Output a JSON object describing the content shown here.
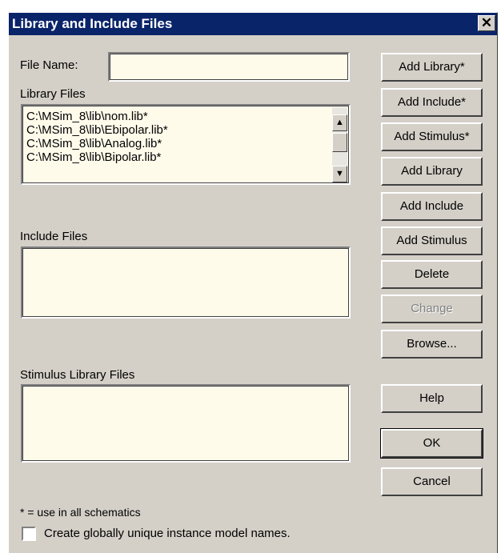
{
  "dialog": {
    "title": "Library and Include Files",
    "close_label": "✕"
  },
  "file_name": {
    "label": "File Name:",
    "value": "",
    "placeholder": ""
  },
  "library_files": {
    "label": "Library Files",
    "items": [
      "C:\\MSim_8\\lib\\nom.lib*",
      "C:\\MSim_8\\lib\\Ebipolar.lib*",
      "C:\\MSim_8\\lib\\Analog.lib*",
      "C:\\MSim_8\\lib\\Bipolar.lib*"
    ],
    "scroll_up_icon": "▲",
    "scroll_down_icon": "▼"
  },
  "include_files": {
    "label": "Include Files",
    "items": []
  },
  "stimulus_files": {
    "label": "Stimulus Library Files",
    "items": []
  },
  "buttons": {
    "add_library_global": "Add Library*",
    "add_include_global": "Add Include*",
    "add_stimulus_global": "Add Stimulus*",
    "add_library": "Add Library",
    "add_include": "Add Include",
    "add_stimulus": "Add Stimulus",
    "delete": "Delete",
    "change": "Change",
    "browse": "Browse...",
    "help": "Help",
    "ok": "OK",
    "cancel": "Cancel"
  },
  "footnote": "* = use in all schematics",
  "checkbox": {
    "label": "Create globally unique instance model names.",
    "checked": false
  }
}
